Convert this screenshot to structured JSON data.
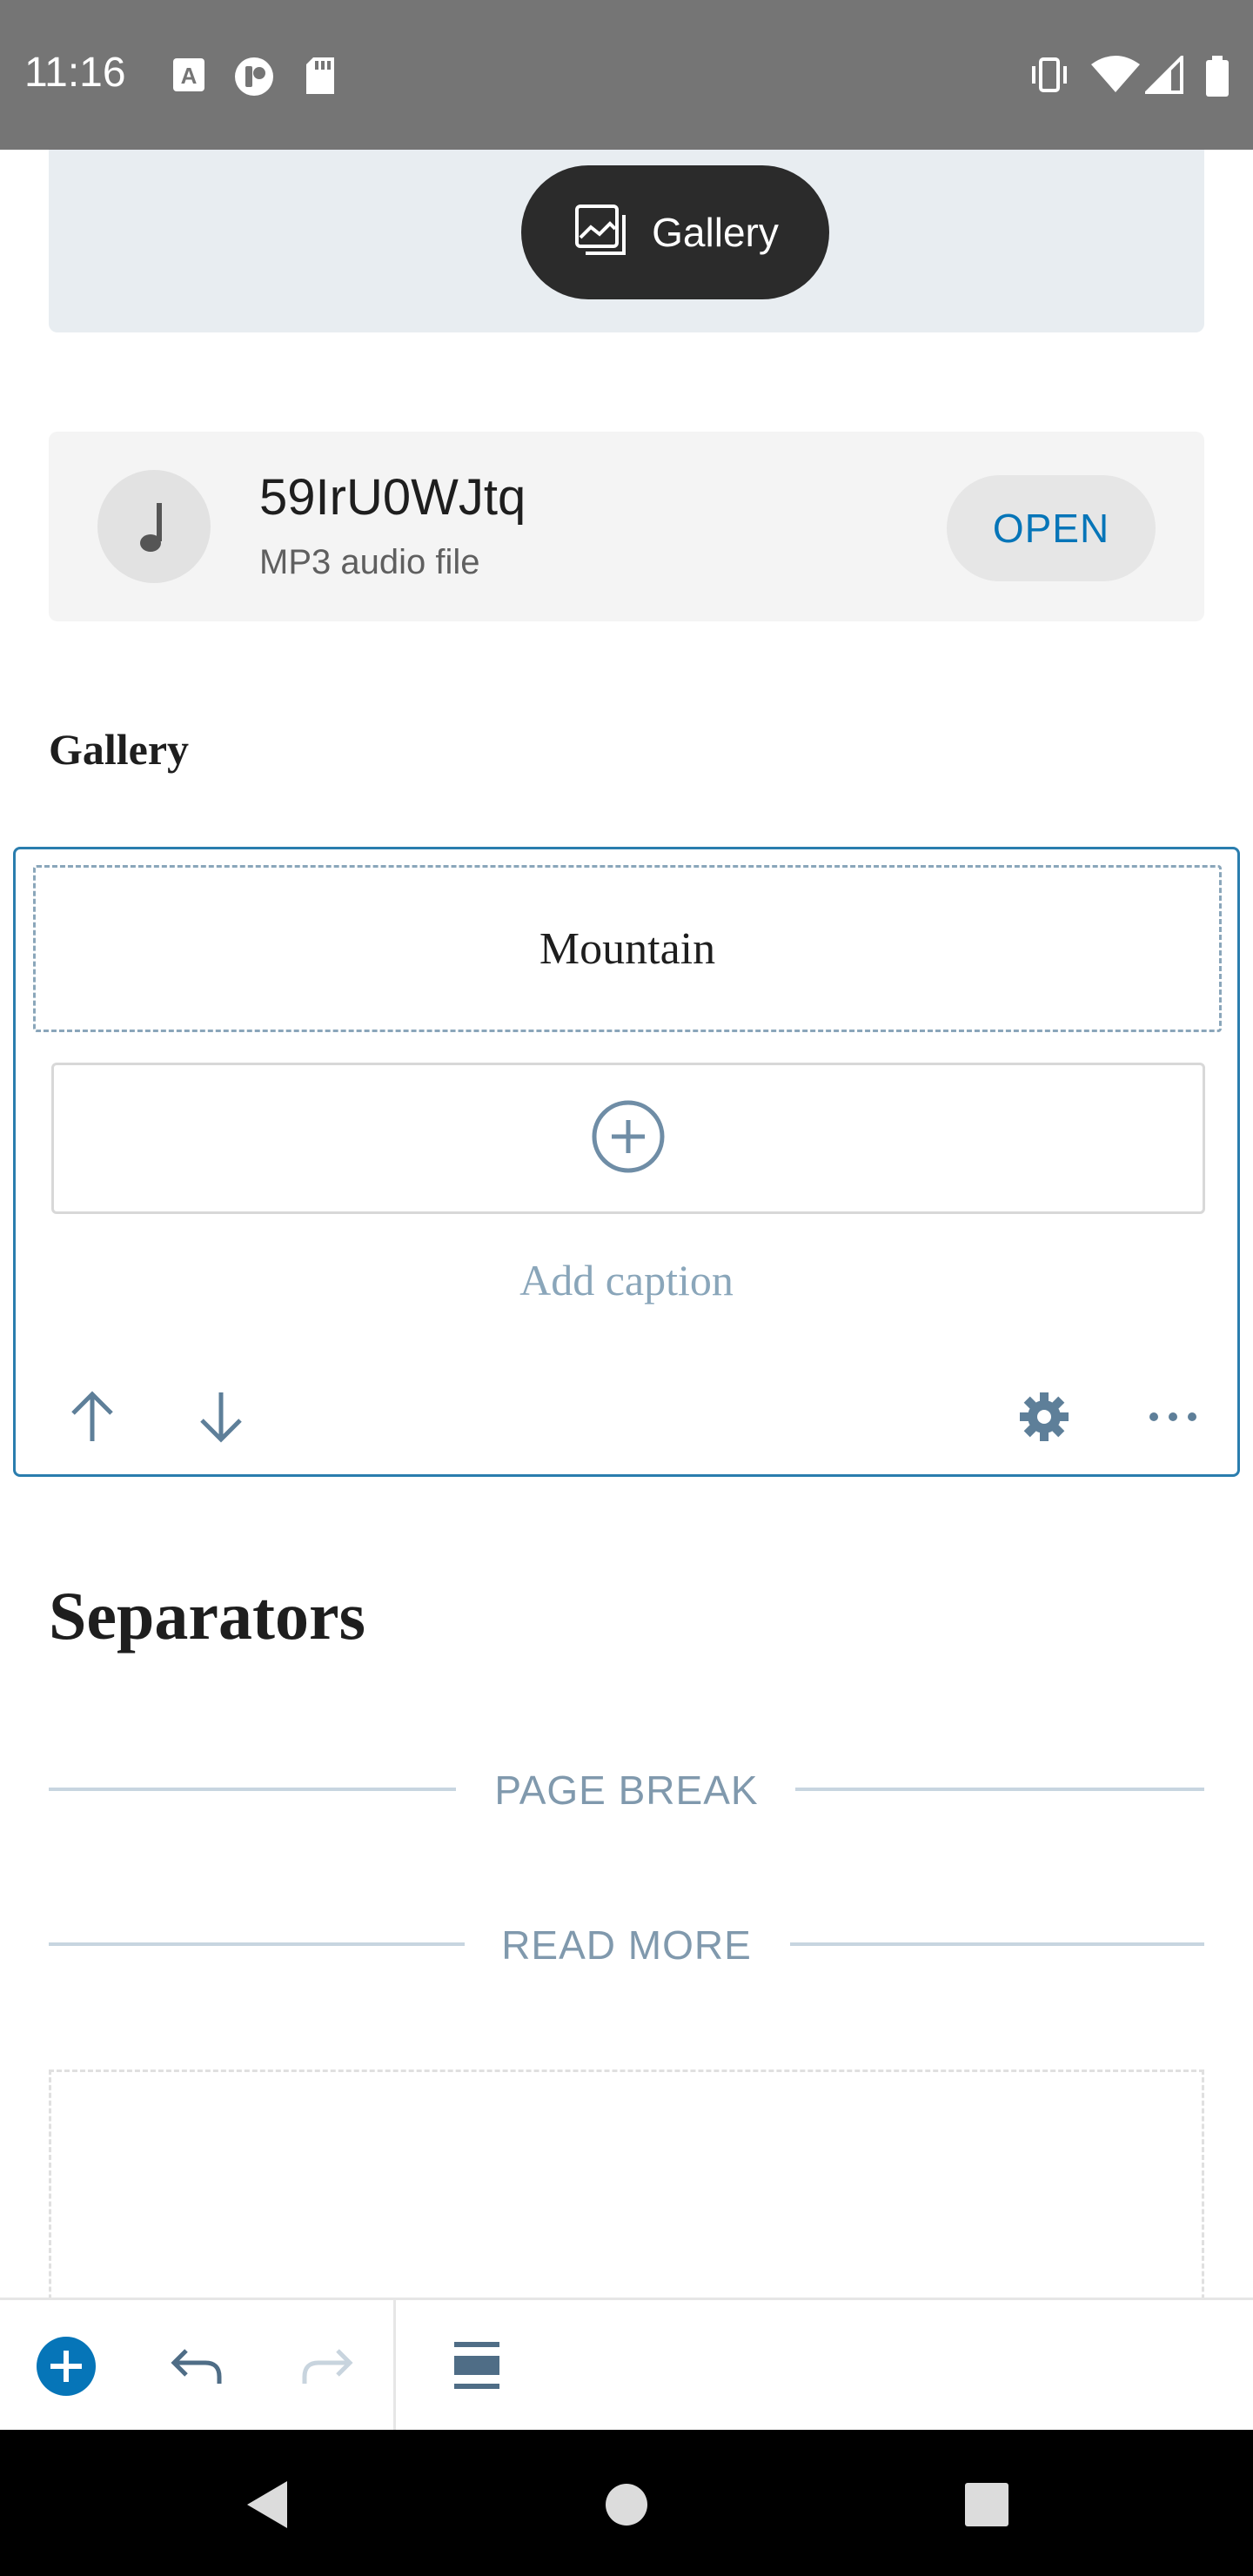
{
  "status_bar": {
    "time": "11:16",
    "left_icons": [
      "keyboard-a-icon",
      "app-badge-icon",
      "sd-card-icon"
    ],
    "right_icons": [
      "vibrate-icon",
      "wifi-icon",
      "signal-icon",
      "battery-icon"
    ]
  },
  "gallery_banner": {
    "button_label": "Gallery",
    "icon": "gallery-icon"
  },
  "audio_block": {
    "title": "59IrU0WJtq",
    "subtitle": "MP3 audio file",
    "open_label": "OPEN",
    "icon": "music-note-icon"
  },
  "gallery_section": {
    "heading": "Gallery",
    "image_caption": "Mountain",
    "add_caption_placeholder": "Add caption",
    "toolbar_icons": [
      "arrow-up-icon",
      "arrow-down-icon",
      "gear-icon",
      "more-horizontal-icon"
    ]
  },
  "separators_section": {
    "heading": "Separators",
    "page_break_label": "PAGE BREAK",
    "read_more_label": "READ MORE"
  },
  "editor_toolbar": {
    "icons": [
      "add-block-icon",
      "undo-icon",
      "redo-icon",
      "layout-icon"
    ]
  },
  "colors": {
    "accent": "#0675b8",
    "block_border": "#2a7dae",
    "muted": "#8aa6ba",
    "status_bar": "#757575",
    "pill": "#2b2b2b"
  },
  "nav_bar": {
    "icons": [
      "back-icon",
      "home-icon",
      "recents-icon"
    ]
  }
}
